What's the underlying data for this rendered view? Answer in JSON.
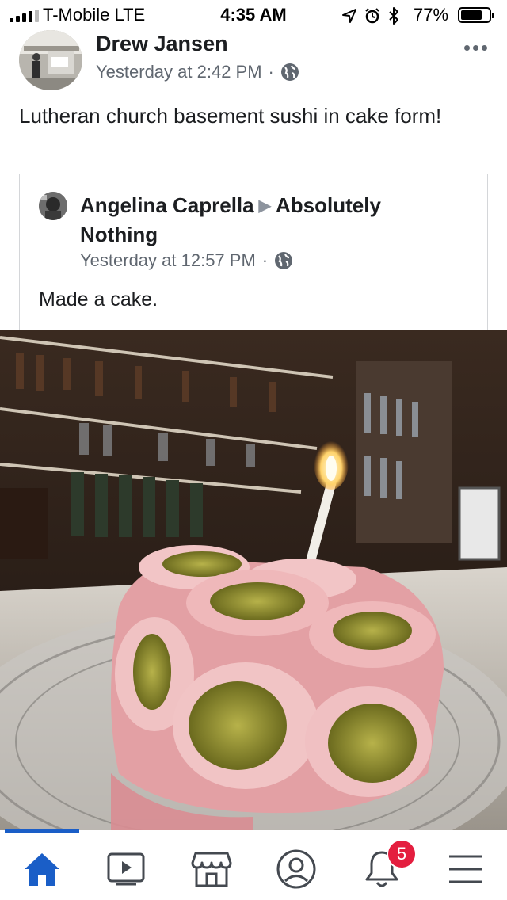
{
  "status_bar": {
    "carrier": "T-Mobile  LTE",
    "time": "4:35 AM",
    "battery": "77%",
    "battery_level": 0.77
  },
  "post": {
    "author": "Drew Jansen",
    "timestamp": "Yesterday at 2:42 PM",
    "separator": "·",
    "text": "Lutheran church basement sushi in cake form!"
  },
  "shared": {
    "author": "Angelina Caprella",
    "target": "Absolutely Nothing",
    "timestamp": "Yesterday at 12:57 PM",
    "separator": "·",
    "text": "Made a cake."
  },
  "nav": {
    "items": [
      "home-icon",
      "video-icon",
      "marketplace-icon",
      "profile-icon",
      "notifications-icon",
      "menu-icon"
    ],
    "notification_count": "5",
    "accent": "#1a5ec7",
    "badge_color": "#e41e3f"
  }
}
